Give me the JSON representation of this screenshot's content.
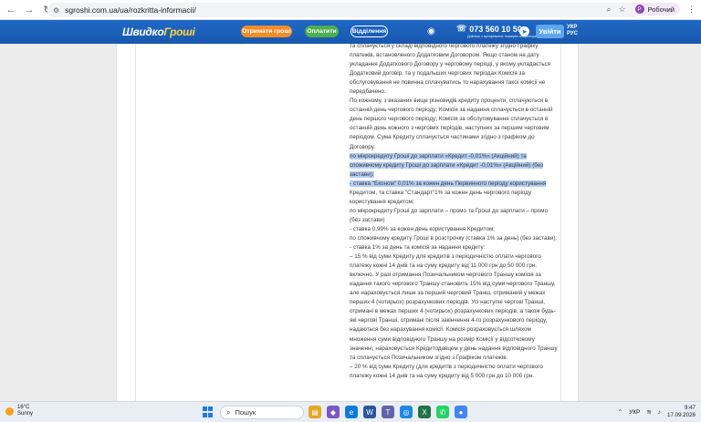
{
  "browser": {
    "url": "sgroshi.com.ua/ua/rozkritta-informacii/",
    "profile_initial": "Р",
    "profile_label": "Робочий"
  },
  "site": {
    "logo_part1": "Швидко",
    "logo_part2": "Гроші",
    "btn_get_money": "Отримати гроші",
    "btn_pay": "Оплатити",
    "btn_branches": "Відділення",
    "phone": "073 560 10 50",
    "phone_sub": "Дзвінок з профільних номерів оператора",
    "btn_login": "Увійти",
    "lang_ukr": "УКР",
    "lang_rus": "РУС"
  },
  "document": {
    "paragraphs": [
      {
        "text": "та сплачується у складі відповідного чергового платежу згідно Графіку платежів, встановленого Додатковим Договором. Якщо станом на дату укладання Додаткового Договору у черговому періоді, у якому укладається Додатковий договір, та у подальших чергових періодах Комісія за обслуговування не повинна сплачуватись то нарахування такої комісії не передбачено.",
        "highlight": false
      },
      {
        "text": "По кожному, з вказаних вище різновидів кредиту проценти, сплачуються в останній день чергового періоду; Комісія за надання сплачується в останній день першого чергового періоду; Комісія за обслуговування сплачується в останній день кожного з чергових періодів, наступних за першим черговим періодом. Сума Кредиту сплачується частинами  згідно з графіком до Договору.",
        "highlight": false
      },
      {
        "text": "по мікрокредиту Гроші до зарплати «Кредит -0,01%» (Акційний) та споживчому кредиту Гроші до зарплати «Кредит -0,01%» (Акційний) (без застави):",
        "highlight": true
      },
      {
        "text": "- ставка \"Економ\" 0,01% за кожен день Первинного періоду користування",
        "highlight": true
      },
      {
        "text": "Кредитом, та ставка \"Стандарт\"1% за кожен день чергового періоду користування кредитом;",
        "highlight": false
      },
      {
        "text": "по мікрокредиту Гроші до зарплати – промо та Гроші до зарплати – промо (без застави)",
        "highlight": false
      },
      {
        "text": "- ставка 0,99% за кожен день користування Кредитом;",
        "highlight": false
      },
      {
        "text": "по споживчому кредиту Гроші в розстрочку (ставка 1% за день) (без застави):",
        "highlight": false
      },
      {
        "text": "- ставка 1% за день та комісія за надання кредиту:",
        "highlight": false
      },
      {
        "text": "– 15 %  від суми Кредиту для кредитів з періодичністю оплати чергового платежу кожні 14 днів та на суму кредиту від 11 000 грн до 50 000 грн. включно. У разі отримання Позичальником чергового Траншу комісія за надання такого чергового Траншу становить 15% від суми чергового Траншу, але нараховується лише за перший черговий Транш, отриманий у межах перших 4 (чотирьох) розрахункових періодів. Усі наступні чергові Транші, отримані в межах перших 4 (чотирьох) розрахункових періодів, а також будь-які чергові Транші, отримані після закінчення 4-го розрахункового періоду, надаються без нарахування комісії. Комісія розраховується шляхом множення суми відповідного Траншу на розмір Комісії у відсотковому значенні, нараховується Кредитодавцем у день надання відповідного Траншу та сплачується Позичальником згідно з Графіком платежів.",
        "highlight": false
      },
      {
        "text": "– 20 %  від суми Кредиту (для кредитів з періодичністю оплати чергового платежу кожні 14 днів та на суму кредиту від 5 000 грн до 10 000 грн.",
        "highlight": false
      }
    ]
  },
  "taskbar": {
    "temp": "16°C",
    "weather": "Sunny",
    "search_label": "Пошук",
    "lang": "УКР",
    "time": "9:47",
    "date": "17.09.2026"
  }
}
